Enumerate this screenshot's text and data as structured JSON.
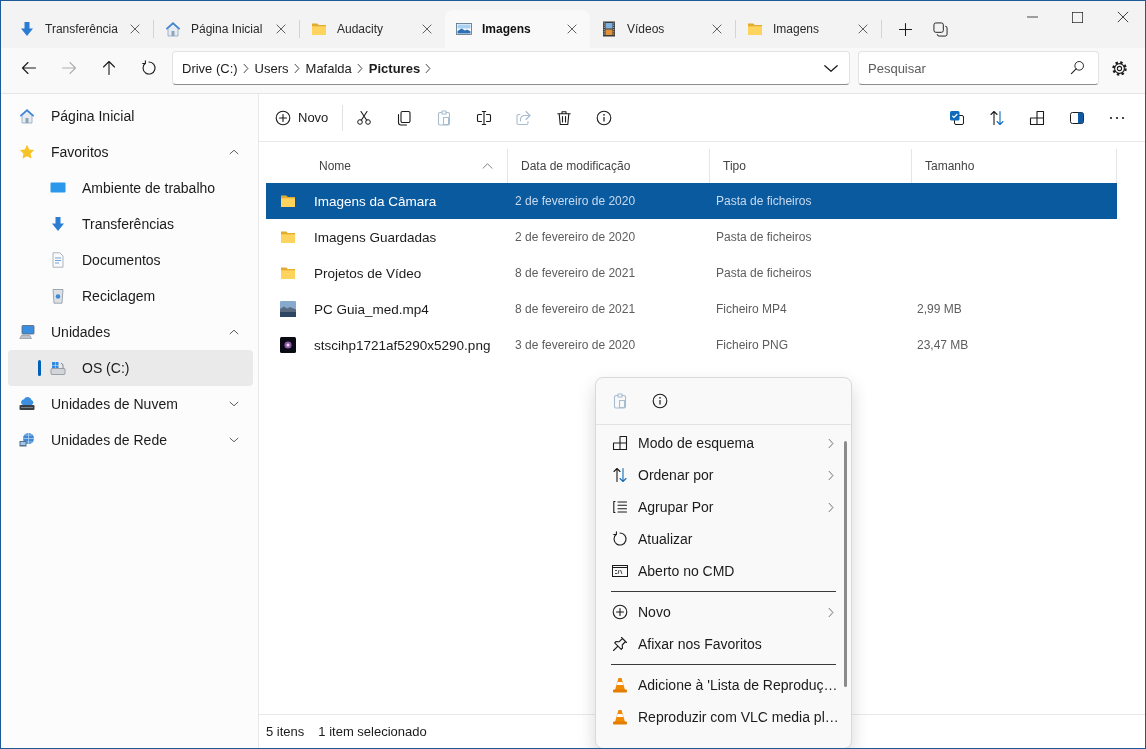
{
  "tabs": [
    {
      "label": "Transferência",
      "kind": "downloads",
      "selected": false
    },
    {
      "label": "Página Inicial",
      "kind": "home",
      "selected": false
    },
    {
      "label": "Audacity",
      "kind": "folder",
      "selected": false
    },
    {
      "label": "Imagens",
      "kind": "pictures",
      "selected": true
    },
    {
      "label": "Vídeos",
      "kind": "videos",
      "selected": false
    },
    {
      "label": "Imagens",
      "kind": "folder",
      "selected": false
    }
  ],
  "navigation": [
    {
      "kind": "back",
      "disabled": false
    },
    {
      "kind": "forward",
      "disabled": true
    },
    {
      "kind": "up",
      "disabled": false
    },
    {
      "kind": "refresh",
      "disabled": false
    }
  ],
  "address_bar": {
    "breadcrumbs": [
      {
        "label": "Drive (C:)",
        "current": false
      },
      {
        "label": "Users",
        "current": false
      },
      {
        "label": "Mafalda",
        "current": false
      },
      {
        "label": "Pictures",
        "current": true
      }
    ]
  },
  "search": {
    "placeholder": "Pesquisar"
  },
  "sidebar": {
    "items": [
      {
        "label": "Página Inicial",
        "kind": "home",
        "selected": false
      },
      {
        "label": "Favoritos",
        "kind": "star",
        "selected": false,
        "expanded": true,
        "children": [
          {
            "label": "Ambiente de trabalho",
            "kind": "desktop",
            "selected": false
          },
          {
            "label": "Transferências",
            "kind": "downloads",
            "selected": false
          },
          {
            "label": "Documentos",
            "kind": "documents",
            "selected": false
          },
          {
            "label": "Reciclagem",
            "kind": "recycle",
            "selected": false
          }
        ]
      },
      {
        "label": "Unidades",
        "kind": "computer",
        "selected": false,
        "expanded": true,
        "children": [
          {
            "label": "OS (C:)",
            "kind": "drive",
            "selected": true
          }
        ]
      },
      {
        "label": "Unidades de Nuvem",
        "kind": "cloud",
        "selected": false,
        "expanded": false
      },
      {
        "label": "Unidades de Rede",
        "kind": "network",
        "selected": false,
        "expanded": false
      }
    ]
  },
  "toolbar": {
    "new_label": "Novo",
    "actions": [
      {
        "kind": "cut",
        "disabled": false
      },
      {
        "kind": "copy",
        "disabled": false
      },
      {
        "kind": "paste",
        "disabled": true
      },
      {
        "kind": "rename",
        "disabled": false
      },
      {
        "kind": "share",
        "disabled": true
      },
      {
        "kind": "delete",
        "disabled": false
      },
      {
        "kind": "properties",
        "disabled": false
      }
    ],
    "view_actions": [
      {
        "kind": "select"
      },
      {
        "kind": "sort"
      },
      {
        "kind": "layout"
      },
      {
        "kind": "preview"
      },
      {
        "kind": "more"
      }
    ]
  },
  "table": {
    "columns": [
      {
        "label": "Nome",
        "sorted": true
      },
      {
        "label": "Data de modificação",
        "sorted": false
      },
      {
        "label": "Tipo",
        "sorted": false
      },
      {
        "label": "Tamanho",
        "sorted": false
      }
    ],
    "rows": [
      {
        "kind": "folder",
        "name": "Imagens da Câmara",
        "modified": "2 de fevereiro de 2020",
        "type": "Pasta de ficheiros",
        "selected": true
      },
      {
        "kind": "folder",
        "name": "Imagens Guardadas",
        "modified": "2 de fevereiro de 2020",
        "type": "Pasta de ficheiros",
        "selected": false
      },
      {
        "kind": "folder",
        "name": "Projetos de Vídeo",
        "modified": "8 de fevereiro de 2021",
        "type": "Pasta de ficheiros",
        "selected": false
      },
      {
        "kind": "video",
        "name": "PC Guia_med.mp4",
        "modified": "8 de fevereiro de 2021",
        "type": "Ficheiro MP4",
        "size": "2,99 MB",
        "selected": false
      },
      {
        "kind": "image",
        "name": "stscihp1721af5290x5290.png",
        "modified": "3 de fevereiro de 2020",
        "type": "Ficheiro PNG",
        "size": "23,47 MB",
        "selected": false
      }
    ]
  },
  "status_bar": {
    "item_count": "5 itens",
    "selection": "1 item selecionado"
  },
  "context_menu": {
    "quick_actions": [
      {
        "kind": "paste",
        "disabled": true
      },
      {
        "kind": "properties",
        "disabled": false
      }
    ],
    "sections": [
      {
        "items": [
          {
            "label": "Modo de esquema",
            "kind": "layout",
            "submenu": true
          },
          {
            "label": "Ordenar por",
            "kind": "sort",
            "submenu": true
          },
          {
            "label": "Agrupar Por",
            "kind": "group",
            "submenu": true
          },
          {
            "label": "Atualizar",
            "kind": "refresh",
            "submenu": false
          },
          {
            "label": "Aberto no CMD",
            "kind": "cmd",
            "submenu": false
          }
        ]
      },
      {
        "items": [
          {
            "label": "Novo",
            "kind": "new",
            "submenu": true
          },
          {
            "label": "Afixar nos Favoritos",
            "kind": "pin",
            "submenu": false
          }
        ]
      },
      {
        "items": [
          {
            "label": "Adicione à 'Lista de Reproduç…",
            "kind": "vlc",
            "submenu": false
          },
          {
            "label": "Reproduzir com VLC media pl…",
            "kind": "vlc",
            "submenu": false
          }
        ]
      }
    ]
  }
}
